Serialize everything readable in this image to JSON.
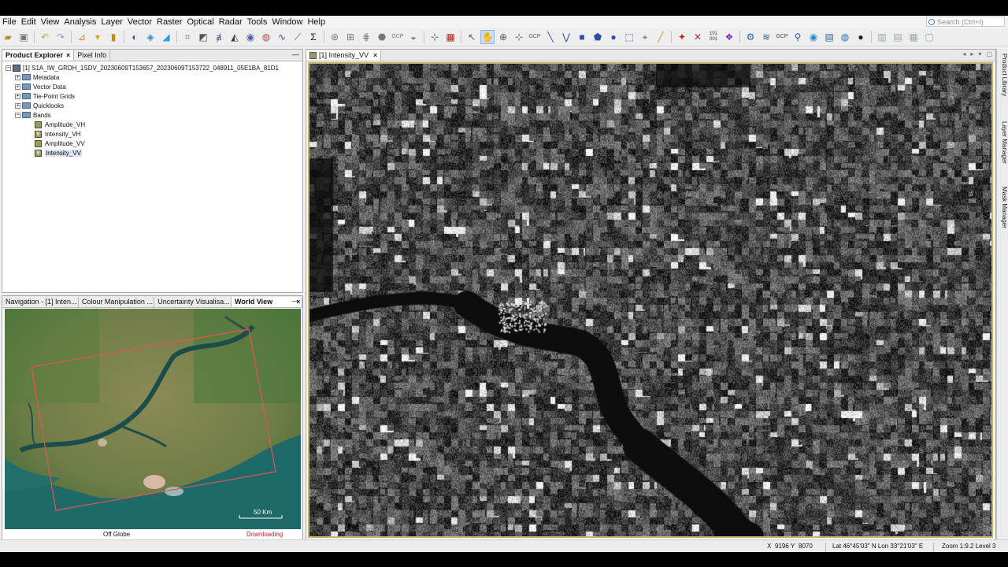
{
  "menubar": {
    "items": [
      "File",
      "Edit",
      "View",
      "Analysis",
      "Layer",
      "Vector",
      "Raster",
      "Optical",
      "Radar",
      "Tools",
      "Window",
      "Help"
    ],
    "search_placeholder": "Search (Ctrl+I)"
  },
  "toolbar": {
    "icons": [
      "open-product-icon",
      "save-product-icon",
      "undo-icon",
      "redo-icon",
      "band-maths-icon",
      "filter-icon",
      "import-icon",
      "colour-icon",
      "graph-icon",
      "magic-wand-icon",
      "rgb-icon",
      "spectrum-icon",
      "histogram-icon",
      "scatter-icon",
      "profile-icon",
      "statistics-icon",
      "layers-icon",
      "pin-icon",
      "gcp-manager-icon",
      "navigation-icon",
      "select-icon",
      "pan-icon",
      "zoom-icon",
      "gcp-tool-icon",
      "line-icon",
      "polyline-icon",
      "rectangle-icon",
      "polygon-icon",
      "ellipse-icon",
      "magic-tool-icon",
      "ruler-icon",
      "range-finder-icon",
      "star-icon",
      "cross-icon",
      "binary-icon",
      "tie-point-icon",
      "gear-icon",
      "globe-icon",
      "sphere-icon"
    ],
    "gcp_label": "GCP",
    "binary_label": "101 001"
  },
  "product_explorer": {
    "tabs": [
      "Product Explorer",
      "Pixel Info"
    ],
    "product": "[1] S1A_IW_GRDH_1SDV_20230609T153657_20230609T153722_048911_05E1BA_81D1",
    "folders": [
      "Metadata",
      "Vector Data",
      "Tie-Point Grids",
      "Quicklooks",
      "Bands"
    ],
    "bands": [
      {
        "name": "Amplitude_VH",
        "virtual": false
      },
      {
        "name": "Intensity_VH",
        "virtual": true
      },
      {
        "name": "Amplitude_VV",
        "virtual": false
      },
      {
        "name": "Intensity_VV",
        "virtual": true
      }
    ]
  },
  "navigation": {
    "tabs": [
      "Navigation - [1] Inten...",
      "Colour Manipulation ...",
      "Uncertainty Visualisa...",
      "World View"
    ],
    "scale_label": "50 Km",
    "globe_mode": "Off Globe",
    "status": "Downloading"
  },
  "image_view": {
    "tab_title": "[1] Intensity_VV"
  },
  "side_panels": [
    "Product Library",
    "Layer Manager",
    "Mask Manager"
  ],
  "statusbar": {
    "x_label": "X",
    "x_value": "9196",
    "y_label": "Y",
    "y_value": "8070",
    "latlon": "Lat 46°45'03\" N  Lon 33°21'03\" E",
    "zoom": "Zoom 1:9.2  Level 3"
  },
  "colors": {
    "river": "#111111",
    "footprint": "#e05555",
    "downloading": "#c21f1f",
    "image_border": "#c8b36a"
  }
}
